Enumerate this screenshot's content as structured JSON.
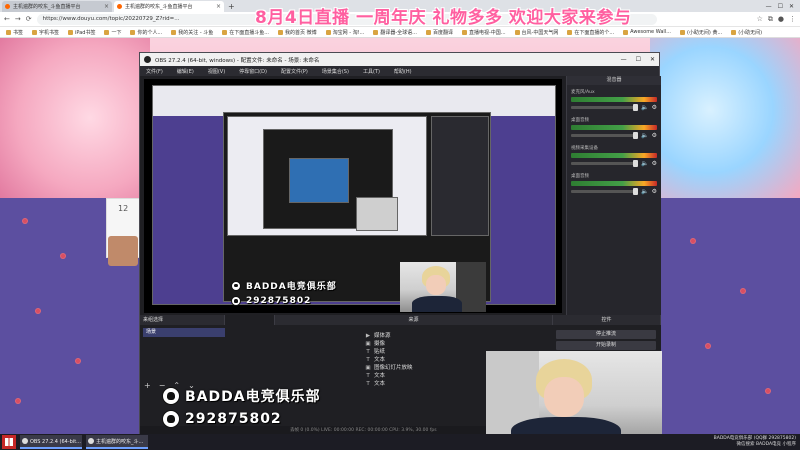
{
  "browser": {
    "tabs": [
      {
        "label": "主机遍群的咬东_斗鱼直播平台",
        "active": false
      },
      {
        "label": "主机遍群的咬东_斗鱼直播平台",
        "active": true
      }
    ],
    "url": "https://www.douyu.com/topic/20220729_Z?rid=...",
    "bookmarks": [
      "书签",
      "宇机书签",
      "iPad书签",
      "一下",
      "你的个人...",
      "我的关注 - 斗鱼",
      "在下面直播斗鱼...",
      "我的首页 微博",
      "淘宝网 - 淘!...",
      "翻译器-全球语...",
      "百度翻译",
      "直播电视-中国...",
      "台风-中国天气网",
      "在下面直播的个...",
      "Awesome Wall...",
      "(小助无间) 黄...",
      "(小助无间)"
    ]
  },
  "overlay": {
    "banner_text": "8月4日直播 一周年庆 礼物多多 欢迎大家来参与",
    "team_name": "BADDA电竞俱乐部",
    "qq_number": "292875802"
  },
  "page": {
    "side_count": "12"
  },
  "obs": {
    "title": "OBS 27.2.4 (64-bit, windows) - 配置文件: 未命名 - 场景: 未命名",
    "menu": [
      "文件(F)",
      "编辑(E)",
      "视图(V)",
      "停靠窗口(D)",
      "配置文件(P)",
      "场景集合(S)",
      "工具(T)",
      "帮助(H)"
    ],
    "mixer_header": "混音器",
    "mixer_channels": [
      {
        "name": "麦克风/Aux"
      },
      {
        "name": "桌面音频"
      },
      {
        "name": "视频采集设备"
      },
      {
        "name": "桌面音频"
      }
    ],
    "docks": {
      "scenes_header": "场景",
      "sources_header": "来源",
      "controls_header": "控件",
      "tabs": [
        "来组选择",
        "场景",
        "来源"
      ],
      "transition_tabs": [
        "转场特效",
        "直接控"
      ],
      "scene_item": "场景",
      "sources": [
        {
          "icon": "▶",
          "label": "媒体源"
        },
        {
          "icon": "▣",
          "label": "摄像"
        },
        {
          "icon": "T",
          "label": "贴纸"
        },
        {
          "icon": "T",
          "label": "文本"
        },
        {
          "icon": "▣",
          "label": "图像幻灯片放映"
        },
        {
          "icon": "T",
          "label": "文本"
        },
        {
          "icon": "T",
          "label": "文本"
        }
      ],
      "controls": [
        "停止推流",
        "开始录制"
      ],
      "footer_buttons": [
        "+",
        "−",
        "⌃",
        "⌄"
      ]
    },
    "status": "丢帧 0 (0.0%)    LIVE: 00:00:00    REC: 00:00:00    CPU: 3.9%, 30.00 fps"
  },
  "taskbar": {
    "items": [
      "OBS 27.2.4 (64-bit...",
      "主机遍群的咬东_斗..."
    ],
    "tray_line1": "BADDA电竞俱乐部 (QQ群 292875802)",
    "tray_line2": "微信搜索 BADDA电竞 小程序"
  }
}
